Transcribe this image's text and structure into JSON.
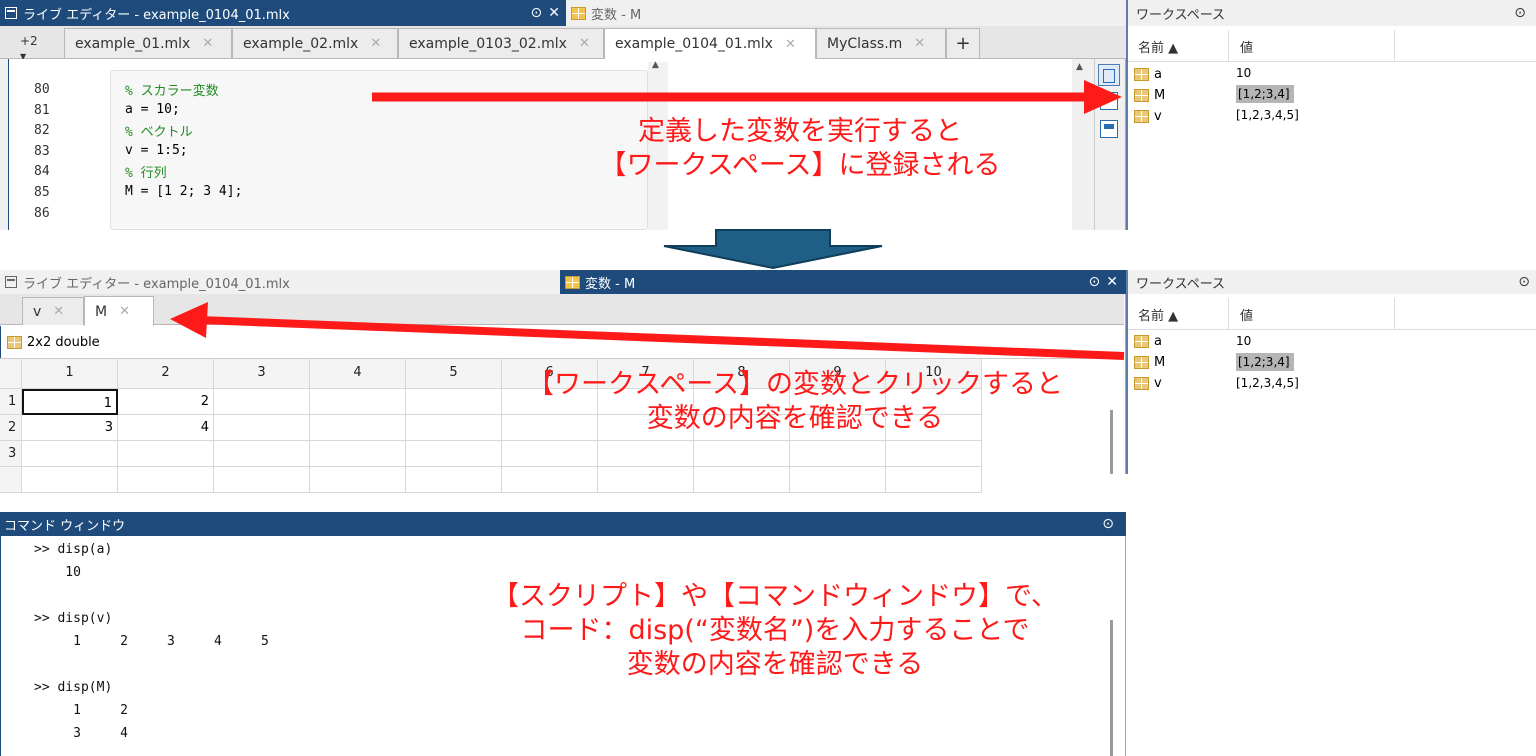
{
  "colors": {
    "title_active": "#1e4b7c",
    "annotation": "#ff1a1a",
    "arrow_down": "#1f5f85",
    "ws_highlight": "#b5b5b5"
  },
  "panel1": {
    "title": "ライブ エディター - example_0104_01.mlx",
    "var_title": "変数 - M",
    "tabs_more": "+2",
    "tabs": [
      "example_01.mlx",
      "example_02.mlx",
      "example_0103_02.mlx",
      "example_0104_01.mlx",
      "MyClass.m"
    ],
    "active_tab": "example_0104_01.mlx",
    "add_tab": "+",
    "lines": [
      {
        "num": "80",
        "code": "% スカラー変数",
        "comment": true
      },
      {
        "num": "81",
        "code": "a = 10;",
        "comment": false
      },
      {
        "num": "82",
        "code": "% ベクトル",
        "comment": true
      },
      {
        "num": "83",
        "code": "v = 1:5;",
        "comment": false
      },
      {
        "num": "84",
        "code": "% 行列",
        "comment": true
      },
      {
        "num": "85",
        "code": "M = [1 2; 3 4];",
        "comment": false
      },
      {
        "num": "86",
        "code": "",
        "comment": false
      }
    ],
    "annotation": [
      "定義した変数を実行すると",
      "【ワークスペース】に登録される"
    ]
  },
  "workspace": {
    "title": "ワークスペース",
    "col_name": "名前 ▲",
    "col_value": "値",
    "vars": [
      {
        "name": "a",
        "value": "10",
        "highlight": false
      },
      {
        "name": "M",
        "value": "[1,2;3,4]",
        "highlight": true
      },
      {
        "name": "v",
        "value": "[1,2,3,4,5]",
        "highlight": false
      }
    ]
  },
  "panel2": {
    "editor_title": "ライブ エディター - example_0104_01.mlx",
    "var_title": "変数 - M",
    "tabs": [
      "v",
      "M"
    ],
    "active_tab": "M",
    "info": "2x2 double",
    "columns": [
      "1",
      "2",
      "3",
      "4",
      "5",
      "6",
      "7",
      "8",
      "9",
      "10"
    ],
    "rows": [
      "1",
      "2",
      "3"
    ],
    "cells": [
      [
        "1",
        "2"
      ],
      [
        "3",
        "4"
      ],
      [
        "",
        ""
      ]
    ],
    "annotation": [
      "【ワークスペース】の変数とクリックすると",
      "変数の内容を確認できる"
    ]
  },
  "command_window": {
    "title": "コマンド ウィンドウ",
    "lines": [
      ">> disp(a)",
      "    10",
      "",
      ">> disp(v)",
      "     1     2     3     4     5",
      "",
      ">> disp(M)",
      "     1     2",
      "     3     4"
    ],
    "annotation": [
      "【スクリプト】や【コマンドウィンドウ】で、",
      "コード：disp(“変数名”)を入力することで",
      "変数の内容を確認できる"
    ]
  }
}
